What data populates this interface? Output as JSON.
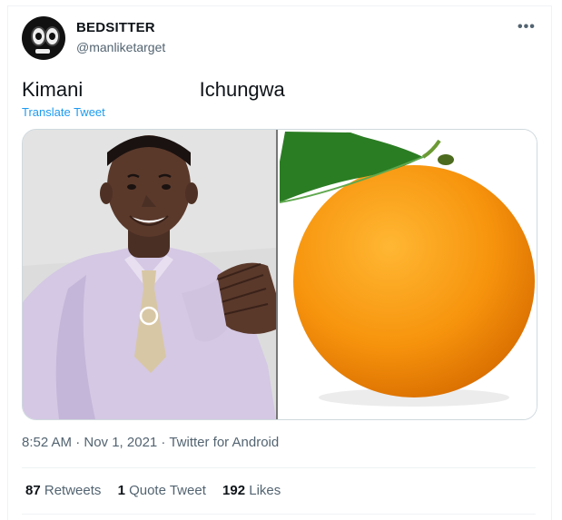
{
  "account": {
    "display_name": "BEDSITTER",
    "handle": "@manliketarget",
    "more_icon": "more-horizontal-icon"
  },
  "tweet": {
    "text": "Kimani                     Ichungwa",
    "translate_label": "Translate Tweet",
    "timestamp": "8:52 AM · Nov 1, 2021",
    "source_separator": " · ",
    "source": "Twitter for Android"
  },
  "media": {
    "left_image": "photo of smiling man in lavender shirt and tie",
    "right_image": "photo of orange fruit with leaf"
  },
  "stats": [
    {
      "count": "87",
      "label": "Retweets"
    },
    {
      "count": "1",
      "label": "Quote Tweet"
    },
    {
      "count": "192",
      "label": "Likes"
    }
  ],
  "colors": {
    "link": "#1d9bf0",
    "secondary_text": "#536471",
    "primary_text": "#0f1419",
    "border": "#cfd9de"
  }
}
